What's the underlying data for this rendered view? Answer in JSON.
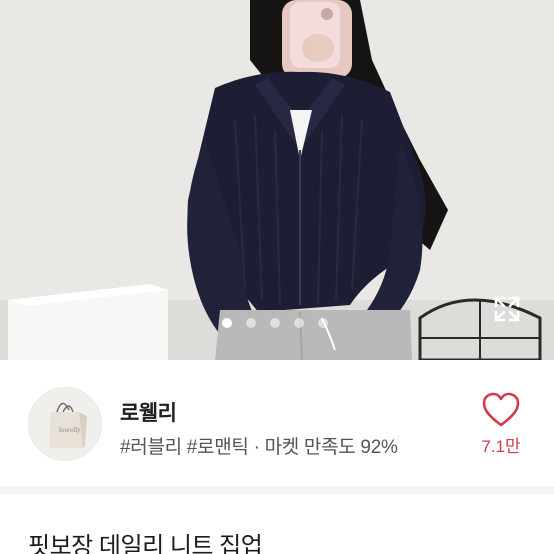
{
  "product_image": {
    "slide_count": 5,
    "active_slide": 1,
    "expand_icon": "expand-icon"
  },
  "shop": {
    "name": "로웰리",
    "tags": "#러블리 #로맨틱 · 마켓 만족도 92%",
    "avatar_icon": "shopping-bag-icon"
  },
  "like": {
    "icon": "heart-icon",
    "count": "7.1만",
    "color": "#d6384d"
  },
  "product": {
    "title": "핏보장 데일리 니트 집업"
  }
}
